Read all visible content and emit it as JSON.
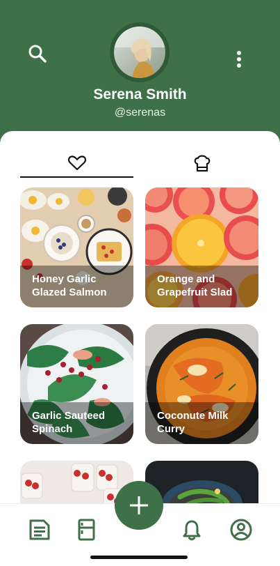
{
  "profile": {
    "name": "Serena Smith",
    "handle": "@serenas"
  },
  "tabs": [
    {
      "icon": "heart-icon",
      "active": true
    },
    {
      "icon": "chef-hat-icon",
      "active": false
    }
  ],
  "recipes": [
    {
      "title": "Honey Garlic Glazed Salmon"
    },
    {
      "title": "Orange and Grapefruit Slad"
    },
    {
      "title": "Garlic Sauteed Spinach"
    },
    {
      "title": "Coconute Milk Curry"
    },
    {
      "title": ""
    },
    {
      "title": ""
    }
  ],
  "nav": {
    "items": [
      "notes-icon",
      "fridge-icon",
      "add-icon",
      "bell-icon",
      "profile-icon"
    ]
  },
  "colors": {
    "brand": "#3f7149",
    "text_dark": "#111111"
  }
}
